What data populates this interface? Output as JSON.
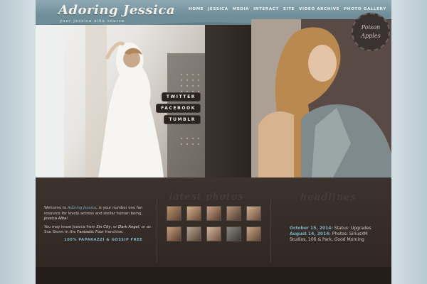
{
  "site": {
    "logo": "Adoring Jessica",
    "tagline": "your jessica alba source"
  },
  "nav": [
    "HOME",
    "JESSICA",
    "MEDIA",
    "INTERACT",
    "SITE",
    "VIDEO ARCHIVE",
    "PHOTO GALLERY"
  ],
  "social": [
    "TWITTER",
    "FACEBOOK",
    "TUMBLR"
  ],
  "badge": {
    "line1": "Poison",
    "line2": "Apples"
  },
  "welcome": {
    "p1_pre": "Welcome to ",
    "p1_link": "Adoring Jessica",
    "p1_post": ", is your number one fan resource for lovely actress and stellar human being, ",
    "p1_em": "Jessica Alba",
    "p1_end": "!",
    "p2_pre": "You may know Jessica from ",
    "p2_em1": "Sin City",
    "p2_mid": ", or ",
    "p2_em2": "Dark Angel",
    "p2_post": ", or as Sue Storm in the ",
    "p2_em3": "Fantastic Four",
    "p2_end": " franchise."
  },
  "promo": "100% PAPARAZZI & GOSSIP FREE",
  "gallery_title": "latest photos",
  "headlines_title": "headlines",
  "news": [
    {
      "date": "October 15, 2014:",
      "text": " Status: Upgrades"
    },
    {
      "date": "August 14, 2014:",
      "text": " Photos: SiriusXM"
    },
    {
      "date": "",
      "text": "Studios, 106 & Park, Good Morning"
    }
  ],
  "colors": {
    "header": "#7a96a0",
    "background": "#2e2622",
    "accent": "#7ab0c2",
    "side": "#c9d6dc"
  }
}
